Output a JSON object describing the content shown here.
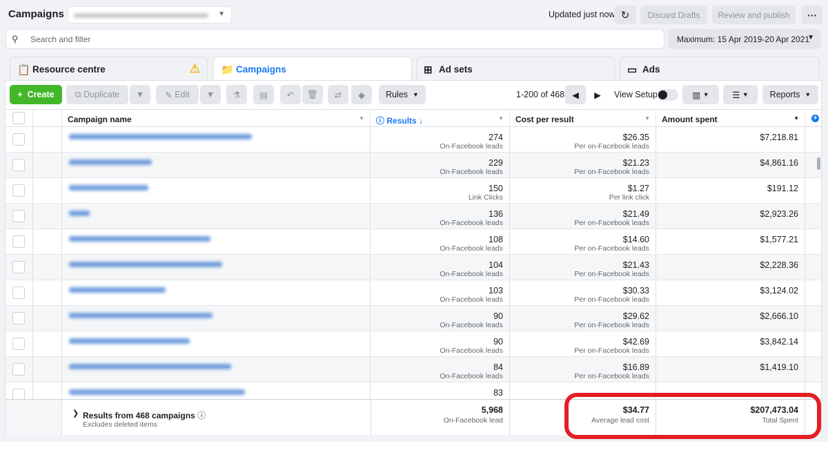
{
  "header": {
    "title": "Campaigns",
    "account_value": "",
    "updated": "Updated just now",
    "discard": "Discard Drafts",
    "review": "Review and publish",
    "more": "···"
  },
  "search": {
    "placeholder": "Search and filter"
  },
  "date_range": "Maximum: 15 Apr 2019-20 Apr 2021",
  "tabs": [
    {
      "label": "Resource centre"
    },
    {
      "label": "Campaigns"
    },
    {
      "label": "Ad sets"
    },
    {
      "label": "Ads"
    }
  ],
  "toolbar": {
    "create": "Create",
    "duplicate": "Duplicate",
    "edit": "Edit",
    "rules": "Rules",
    "range": "1-200 of 468",
    "view_setup": "View Setup",
    "reports": "Reports"
  },
  "columns": {
    "name": "Campaign name",
    "results": "Results",
    "cost": "Cost per result",
    "amount": "Amount spent"
  },
  "rows": [
    {
      "results": "274",
      "results_sub": "On-Facebook leads",
      "cost": "$26.35",
      "cost_sub": "Per on-Facebook leads",
      "amount": "$7,218.81"
    },
    {
      "results": "229",
      "results_sub": "On-Facebook leads",
      "cost": "$21.23",
      "cost_sub": "Per on-Facebook leads",
      "amount": "$4,861.16"
    },
    {
      "results": "150",
      "results_sub": "Link Clicks",
      "cost": "$1.27",
      "cost_sub": "Per link click",
      "amount": "$191.12"
    },
    {
      "results": "136",
      "results_sub": "On-Facebook leads",
      "cost": "$21.49",
      "cost_sub": "Per on-Facebook leads",
      "amount": "$2,923.26"
    },
    {
      "results": "108",
      "results_sub": "On-Facebook leads",
      "cost": "$14.60",
      "cost_sub": "Per on-Facebook leads",
      "amount": "$1,577.21"
    },
    {
      "results": "104",
      "results_sub": "On-Facebook leads",
      "cost": "$21.43",
      "cost_sub": "Per on-Facebook leads",
      "amount": "$2,228.36"
    },
    {
      "results": "103",
      "results_sub": "On-Facebook leads",
      "cost": "$30.33",
      "cost_sub": "Per on-Facebook leads",
      "amount": "$3,124.02"
    },
    {
      "results": "90",
      "results_sub": "On-Facebook leads",
      "cost": "$29.62",
      "cost_sub": "Per on-Facebook leads",
      "amount": "$2,666.10"
    },
    {
      "results": "90",
      "results_sub": "On-Facebook leads",
      "cost": "$42.69",
      "cost_sub": "Per on-Facebook leads",
      "amount": "$3,842.14"
    },
    {
      "results": "84",
      "results_sub": "On-Facebook leads",
      "cost": "$16.89",
      "cost_sub": "Per on-Facebook leads",
      "amount": "$1,419.10"
    },
    {
      "results": "83",
      "results_sub": "",
      "cost": "",
      "cost_sub": "",
      "amount": ""
    }
  ],
  "footer": {
    "title": "Results from 468 campaigns",
    "sub": "Excludes deleted items",
    "results": "5,968",
    "results_sub": "On-Facebook lead",
    "cost": "$34.77",
    "cost_sub": "Average lead cost",
    "amount": "$207,473.04",
    "amount_sub": "Total Spent"
  },
  "colors": {
    "accent": "#1877f2",
    "create": "#42b72a",
    "highlight": "#e31e24"
  }
}
